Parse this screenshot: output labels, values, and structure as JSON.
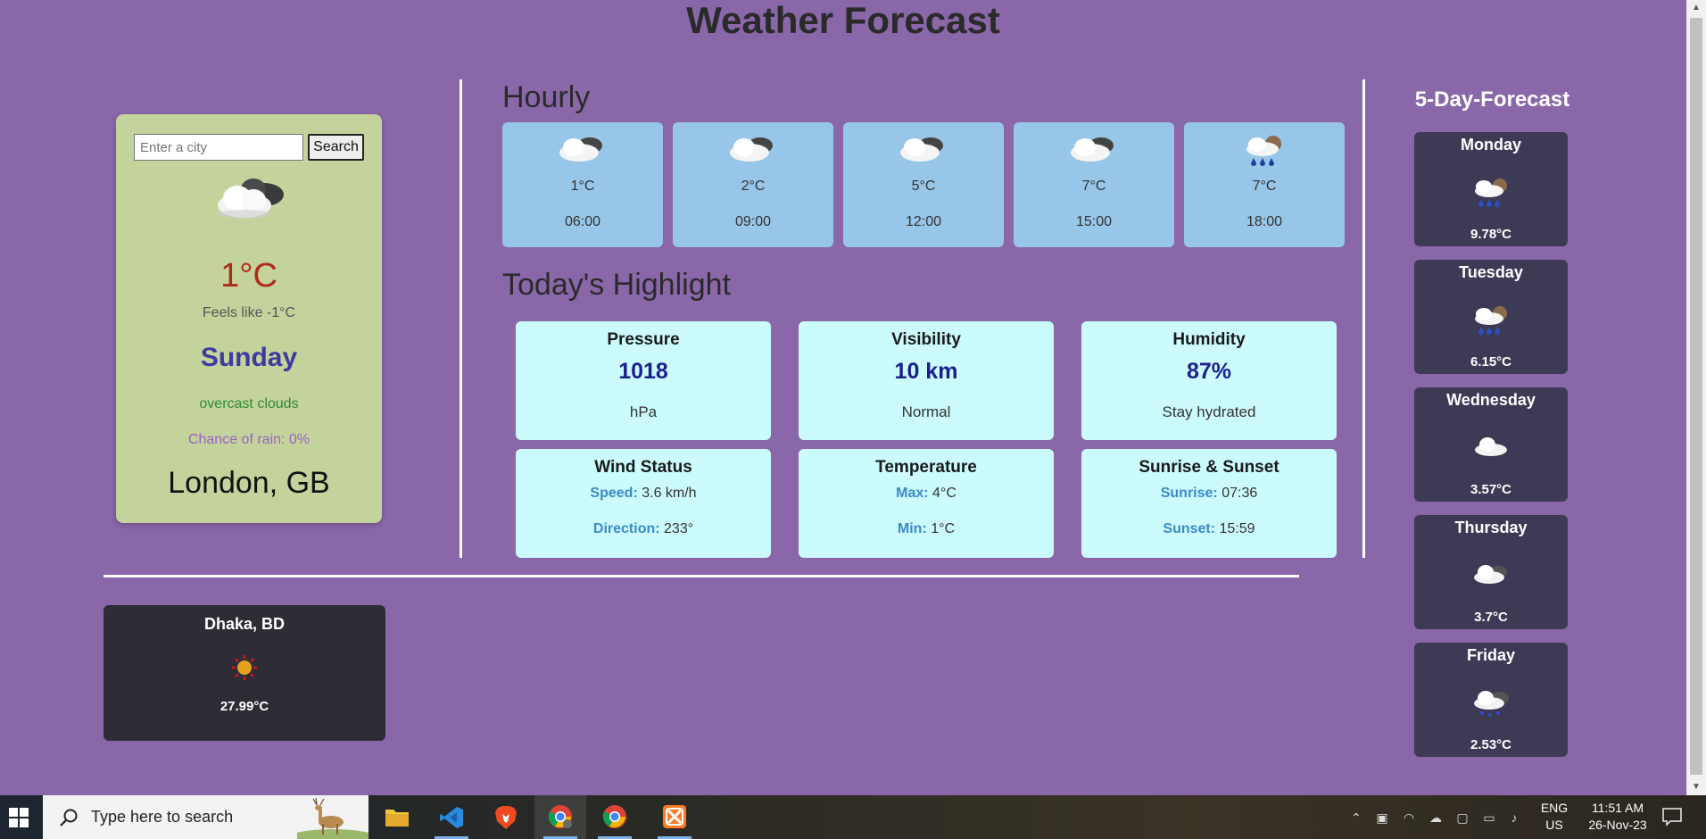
{
  "page": {
    "title": "Weather Forecast"
  },
  "current": {
    "search_placeholder": "Enter a city",
    "search_label": "Search",
    "temperature": "1°C",
    "feels_like": "Feels like -1°C",
    "day": "Sunday",
    "condition": "overcast clouds",
    "chance_of_rain": "Chance of rain: 0%",
    "location": "London, GB",
    "icon": "overcast-cloud-icon"
  },
  "hourly": {
    "heading": "Hourly",
    "items": [
      {
        "temp": "1°C",
        "time": "06:00",
        "icon": "cloud-icon"
      },
      {
        "temp": "2°C",
        "time": "09:00",
        "icon": "cloud-icon"
      },
      {
        "temp": "5°C",
        "time": "12:00",
        "icon": "cloud-icon"
      },
      {
        "temp": "7°C",
        "time": "15:00",
        "icon": "cloud-icon"
      },
      {
        "temp": "7°C",
        "time": "18:00",
        "icon": "rain-icon"
      }
    ]
  },
  "highlights": {
    "heading": "Today's Highlight",
    "pressure": {
      "title": "Pressure",
      "value": "1018",
      "sub": "hPa"
    },
    "visibility": {
      "title": "Visibility",
      "value": "10 km",
      "sub": "Normal"
    },
    "humidity": {
      "title": "Humidity",
      "value": "87%",
      "sub": "Stay hydrated"
    },
    "wind": {
      "title": "Wind Status",
      "speed_label": "Speed:",
      "speed": "3.6 km/h",
      "direction_label": "Direction:",
      "direction": "233°"
    },
    "temperature": {
      "title": "Temperature",
      "max_label": "Max:",
      "max": "4°C",
      "min_label": "Min:",
      "min": "1°C"
    },
    "sun": {
      "title": "Sunrise & Sunset",
      "sunrise_label": "Sunrise:",
      "sunrise": "07:36",
      "sunset_label": "Sunset:",
      "sunset": "15:59"
    }
  },
  "forecast": {
    "heading": "5-Day-Forecast",
    "days": [
      {
        "day": "Monday",
        "temp": "9.78°C",
        "icon": "rain-icon"
      },
      {
        "day": "Tuesday",
        "temp": "6.15°C",
        "icon": "rain-icon"
      },
      {
        "day": "Wednesday",
        "temp": "3.57°C",
        "icon": "white-cloud-icon"
      },
      {
        "day": "Thursday",
        "temp": "3.7°C",
        "icon": "cloud-icon"
      },
      {
        "day": "Friday",
        "temp": "2.53°C",
        "icon": "snow-icon"
      }
    ]
  },
  "saved": {
    "city": "Dhaka, BD",
    "temp": "27.99°C",
    "icon": "sun-icon"
  },
  "taskbar": {
    "search_text": "Type here to search",
    "lang_top": "ENG",
    "lang_bottom": "US",
    "time": "11:51 AM",
    "date": "26-Nov-23"
  }
}
